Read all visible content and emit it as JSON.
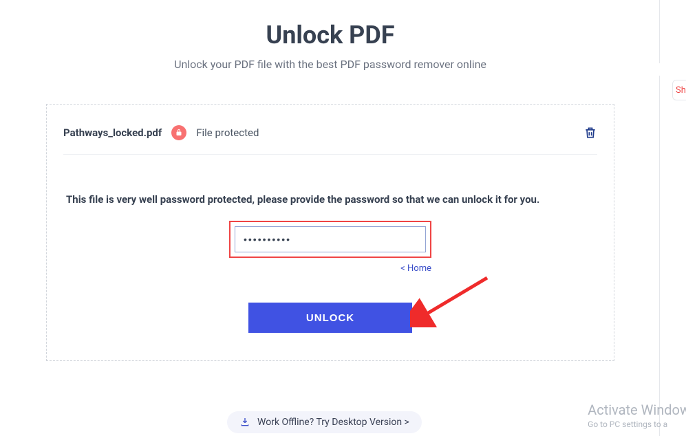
{
  "header": {
    "title": "Unlock PDF",
    "subtitle": "Unlock your PDF file with the best PDF password remover online"
  },
  "file": {
    "name": "Pathways_locked.pdf",
    "status": "File protected"
  },
  "prompt": "This file is very well password protected, please provide the password so that we can unlock it for you.",
  "password": {
    "value": "••••••••••"
  },
  "links": {
    "home": "< Home"
  },
  "buttons": {
    "unlock": "UNLOCK"
  },
  "offline": {
    "label": "Work Offline? Try Desktop Version >"
  },
  "share": {
    "label": "Sh"
  },
  "watermark": {
    "line1": "Activate Window",
    "line2": "Go to PC settings to a"
  }
}
